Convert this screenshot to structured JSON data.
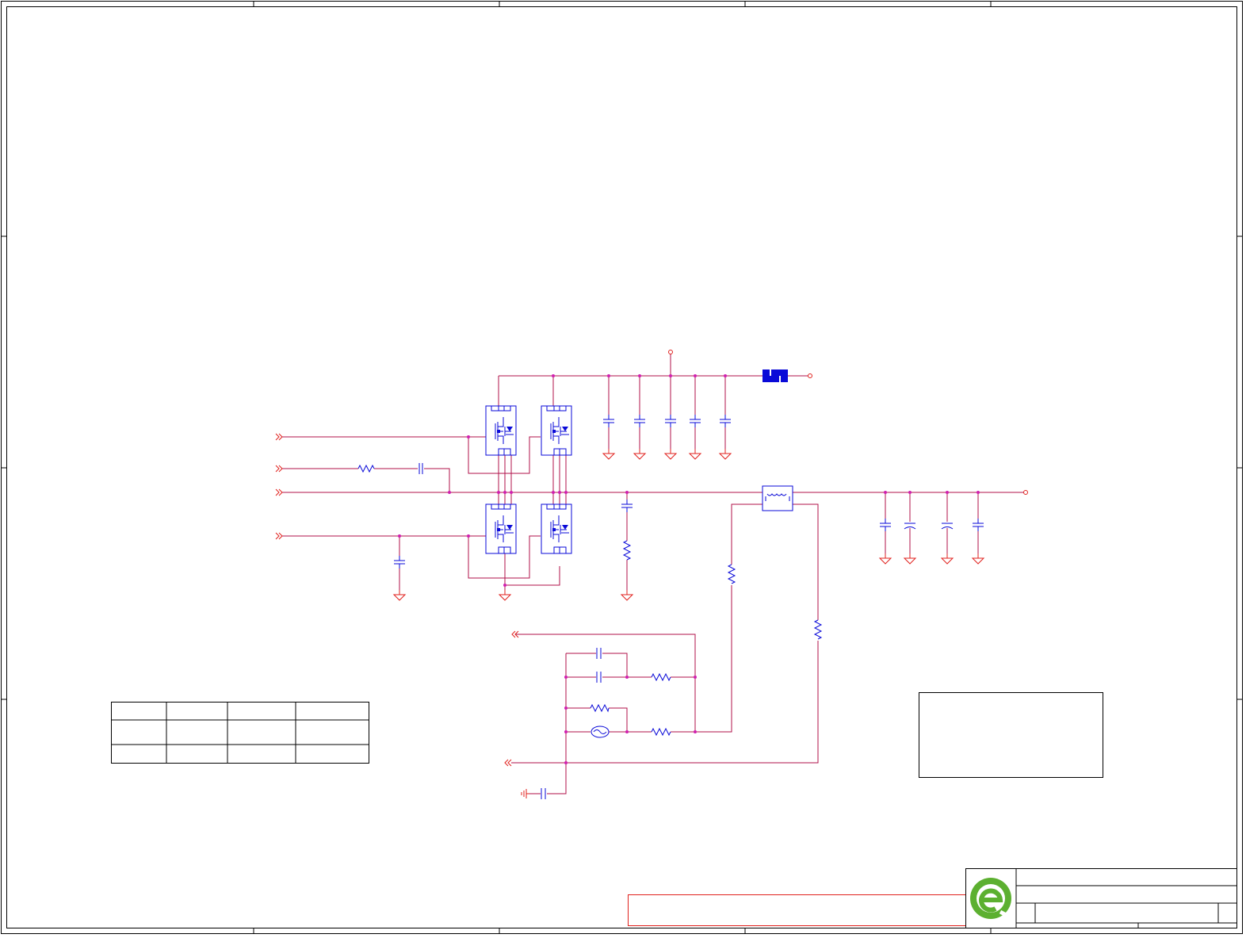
{
  "sheet": {
    "title": "",
    "frame_color": "#000000",
    "wire_color": "#b0104a",
    "power_color": "#e0201c",
    "part_color": "#0a0ad8",
    "junction_color": "#d020b0",
    "logo_color": "#5cb030"
  },
  "icons": {
    "logo": "company-logo-icon",
    "mosfet": "mosfet-icon",
    "capacitor": "capacitor-icon",
    "resistor": "resistor-icon",
    "ground": "ground-icon",
    "port": "port-arrow-icon",
    "inductor": "inductor-icon",
    "fuse": "fuse-icon",
    "thermistor": "thermistor-icon"
  }
}
